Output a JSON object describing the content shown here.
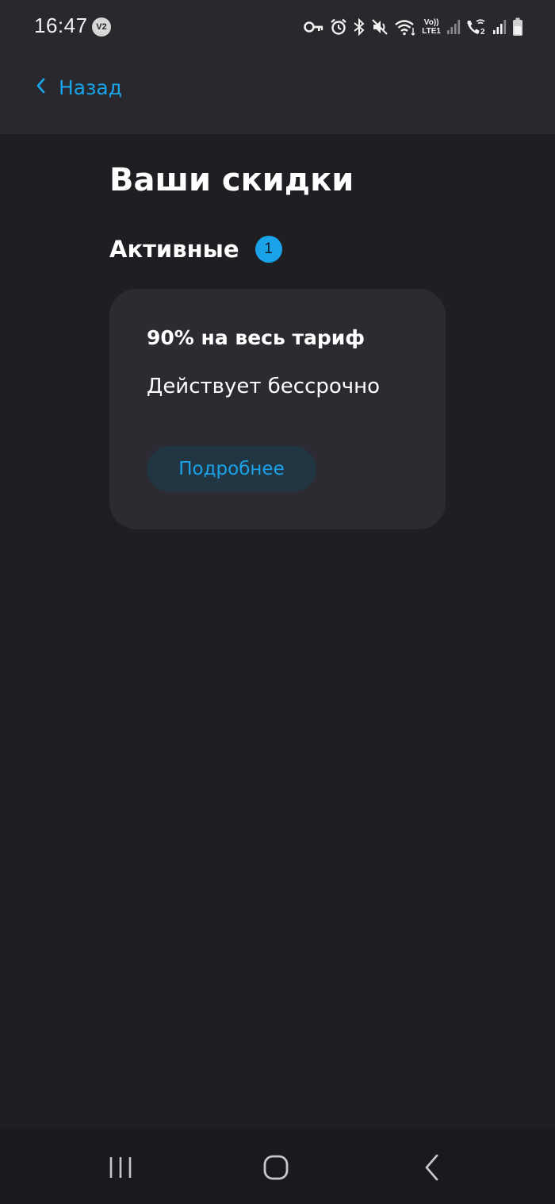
{
  "status_bar": {
    "time": "16:47",
    "badge": "V2",
    "volte_top": "Vo))",
    "volte_bottom": "LTE1",
    "sim2_label": "2",
    "icons": [
      "key-icon",
      "alarm-icon",
      "bluetooth-icon",
      "mute-icon",
      "wifi-icon",
      "volte-icon",
      "signal-icon",
      "wifi-call-icon",
      "signal-icon",
      "battery-icon"
    ]
  },
  "header": {
    "back_label": "Назад",
    "back_icon": "chevron-left-icon"
  },
  "page": {
    "title": "Ваши скидки",
    "section_title": "Активные",
    "active_count": "1"
  },
  "discounts": [
    {
      "title": "90% на весь тариф",
      "validity": "Действует бессрочно",
      "button_label": "Подробнее"
    }
  ],
  "nav_bar": {
    "buttons": [
      "recent-apps-icon",
      "home-icon",
      "back-icon"
    ]
  },
  "colors": {
    "accent": "#1aa3e8",
    "background": "#1f1f23",
    "header_background": "#28282d",
    "card_background": "#2b2b31",
    "button_background": "#213543"
  }
}
